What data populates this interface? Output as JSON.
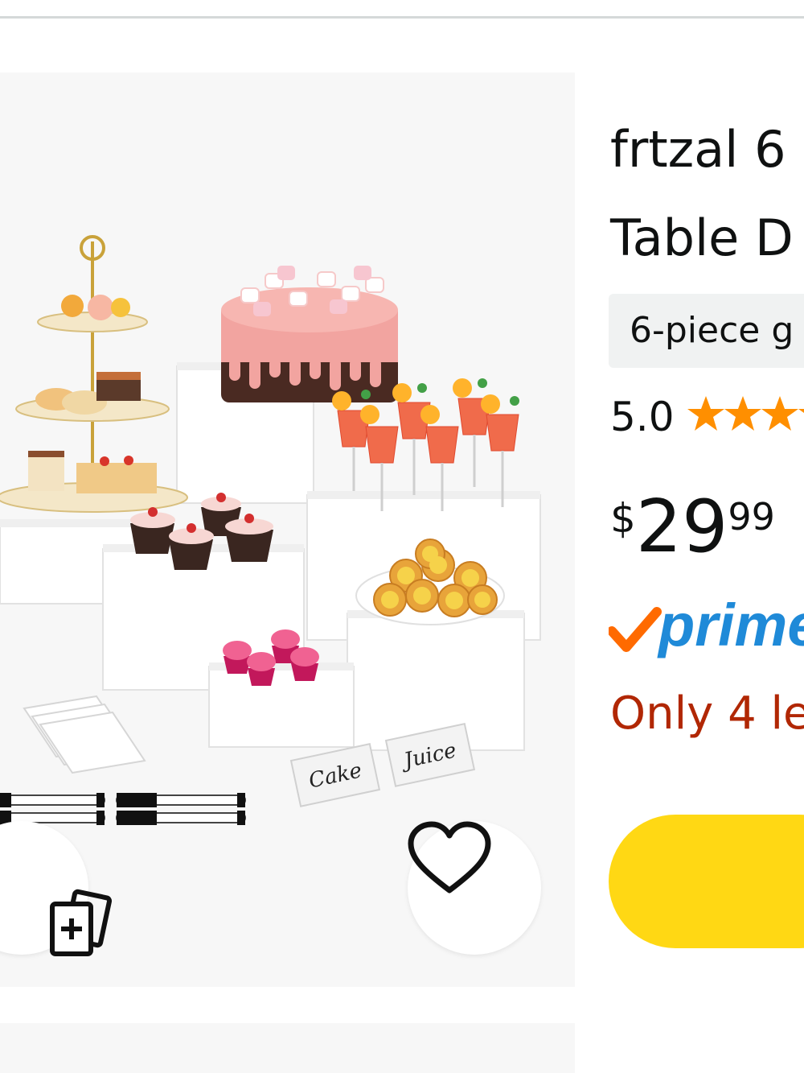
{
  "product": {
    "title_line1": "frtzal 6",
    "title_line2": "Table D",
    "variant_label": "6-piece g",
    "rating": "5.0",
    "price_currency": "$",
    "price_whole": "29",
    "price_fraction": "99",
    "prime_label": "prime",
    "stock_text": "Only 4 le",
    "stars_count": 5
  },
  "image_labels": {
    "tent_card_1": "Cake",
    "tent_card_2": "Juice"
  },
  "icons": {
    "compare": "compare-add-icon",
    "wishlist": "heart-outline-icon",
    "star": "star-icon",
    "prime_check": "prime-check-icon"
  },
  "colors": {
    "star": "#ff8f00",
    "stock": "#b12704",
    "prime_text": "#1f8ad8",
    "prime_check": "#ff6a00",
    "cart_button": "#ffd814",
    "image_bg": "#f7f7f7"
  }
}
